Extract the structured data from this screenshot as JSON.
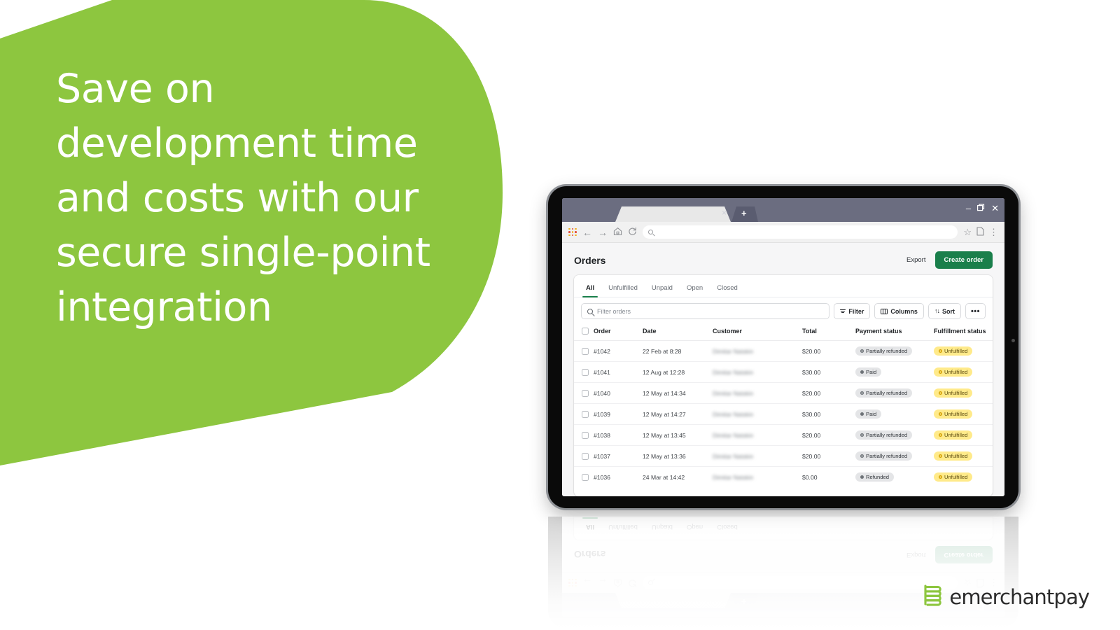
{
  "slide": {
    "headline": "Save on\ndevelopment time\nand costs with our\nsecure single-point\nintegration",
    "brand_green": "#8DC63F",
    "accent_green": "#1a7f4b"
  },
  "logo": {
    "wordmark": "emerchantpay",
    "mark_color": "#8DC63F"
  },
  "browser": {
    "tab_close_label": "×",
    "new_tab_label": "+",
    "window_controls": {
      "minimize": "–",
      "maximize": "❐",
      "close": "✕"
    },
    "nav": {
      "back": "←",
      "forward": "→",
      "home": "⌂",
      "reload": "↻"
    },
    "omnibox_value": "",
    "omnibox_placeholder": "",
    "right_icons": {
      "bookmark": "☆",
      "page": "❐",
      "menu": "⋮"
    }
  },
  "app": {
    "title": "Orders",
    "export_label": "Export",
    "create_order_label": "Create order",
    "tabs": [
      {
        "label": "All",
        "active": true
      },
      {
        "label": "Unfulfilled",
        "active": false
      },
      {
        "label": "Unpaid",
        "active": false
      },
      {
        "label": "Open",
        "active": false
      },
      {
        "label": "Closed",
        "active": false
      }
    ],
    "filterbar": {
      "search_value": "",
      "search_placeholder": "Filter orders",
      "filter_label": "Filter",
      "columns_label": "Columns",
      "sort_label": "Sort",
      "more_label": "•••"
    },
    "table": {
      "columns": [
        "Order",
        "Date",
        "Customer",
        "Total",
        "Payment status",
        "Fulfillment status"
      ],
      "rows": [
        {
          "order": "#1042",
          "date": "22 Feb at 8:28",
          "customer": "Dimitar Natskin",
          "total": "$20.00",
          "payment": "Partially refunded",
          "payment_tone": "grey-hollow",
          "fulfillment": "Unfulfilled"
        },
        {
          "order": "#1041",
          "date": "12 Aug at 12:28",
          "customer": "Dimitar Natskin",
          "total": "$30.00",
          "payment": "Paid",
          "payment_tone": "grey-solid",
          "fulfillment": "Unfulfilled"
        },
        {
          "order": "#1040",
          "date": "12 May at 14:34",
          "customer": "Dimitar Natskin",
          "total": "$20.00",
          "payment": "Partially refunded",
          "payment_tone": "grey-hollow",
          "fulfillment": "Unfulfilled"
        },
        {
          "order": "#1039",
          "date": "12 May at 14:27",
          "customer": "Dimitar Natskin",
          "total": "$30.00",
          "payment": "Paid",
          "payment_tone": "grey-solid",
          "fulfillment": "Unfulfilled"
        },
        {
          "order": "#1038",
          "date": "12 May at 13:45",
          "customer": "Dimitar Natskin",
          "total": "$20.00",
          "payment": "Partially refunded",
          "payment_tone": "grey-hollow",
          "fulfillment": "Unfulfilled"
        },
        {
          "order": "#1037",
          "date": "12 May at 13:36",
          "customer": "Dimitar Natskin",
          "total": "$20.00",
          "payment": "Partially refunded",
          "payment_tone": "grey-hollow",
          "fulfillment": "Unfulfilled"
        },
        {
          "order": "#1036",
          "date": "24 Mar at 14:42",
          "customer": "Dimitar Natskin",
          "total": "$0.00",
          "payment": "Refunded",
          "payment_tone": "grey-solid",
          "fulfillment": "Unfulfilled"
        }
      ]
    }
  }
}
